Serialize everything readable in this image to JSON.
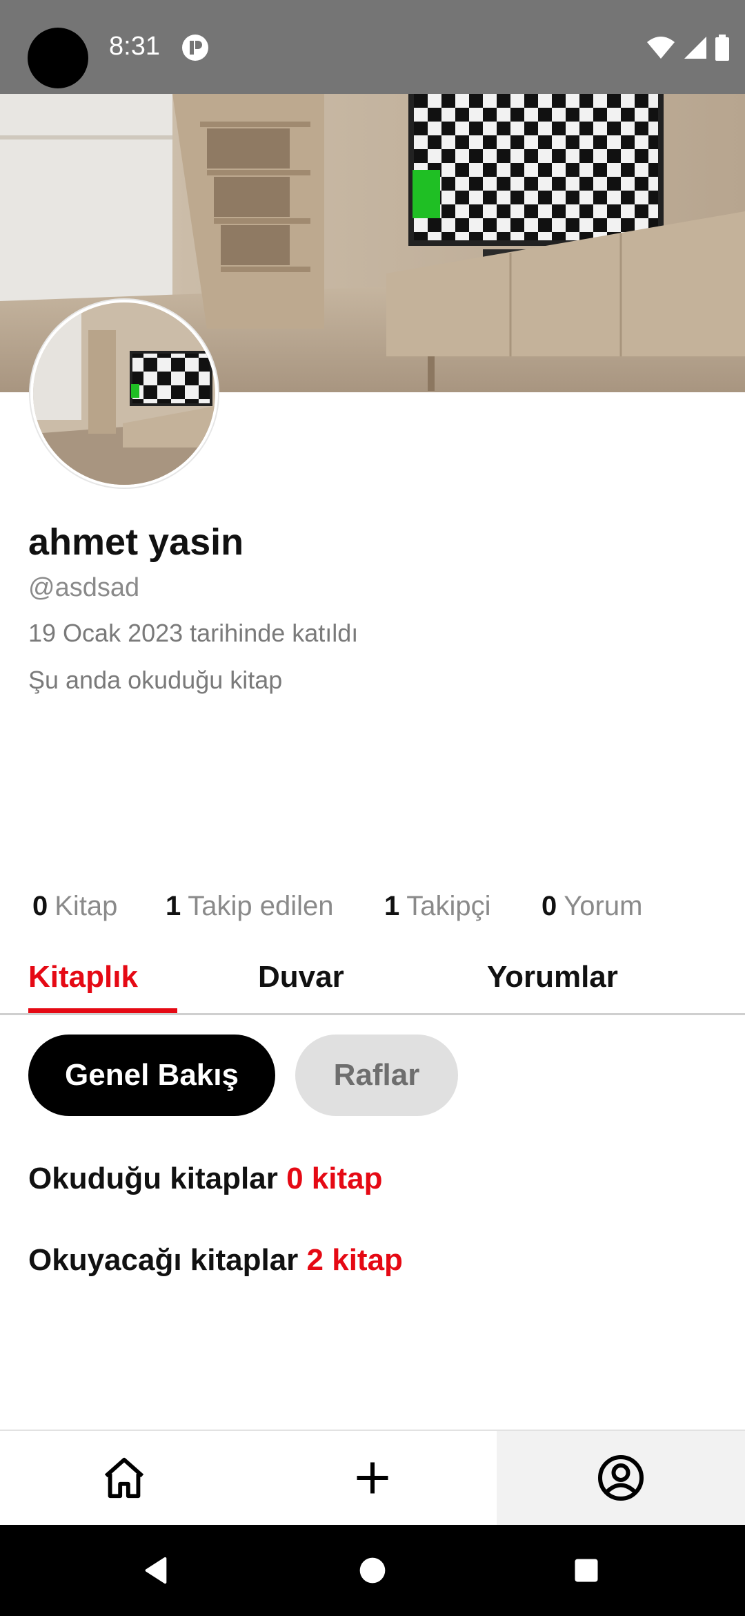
{
  "status_bar": {
    "time": "8:31"
  },
  "profile": {
    "name": "ahmet yasin",
    "handle": "@asdsad",
    "joined": "19 Ocak 2023 tarihinde katıldı",
    "currently_reading": "Şu anda okuduğu kitap"
  },
  "stats": {
    "books": {
      "count": "0",
      "label": "Kitap"
    },
    "following": {
      "count": "1",
      "label": "Takip edilen"
    },
    "followers": {
      "count": "1",
      "label": "Takipçi"
    },
    "reviews": {
      "count": "0",
      "label": "Yorum"
    }
  },
  "tabs": [
    {
      "label": "Kitaplık",
      "active": true
    },
    {
      "label": "Duvar",
      "active": false
    },
    {
      "label": "Yorumlar",
      "active": false
    }
  ],
  "chips": {
    "overview": "Genel Bakış",
    "shelves": "Raflar"
  },
  "books": {
    "read_label": "Okuduğu kitaplar",
    "read_count": "0 kitap",
    "to_read_label": "Okuyacağı kitaplar",
    "to_read_count": "2 kitap"
  },
  "bottom_nav": {
    "items": [
      "home-icon",
      "add-icon",
      "profile-icon"
    ],
    "active": "profile-icon"
  },
  "colors": {
    "accent": "#e50914",
    "status_bar": "#757575",
    "chip_active": "#000000",
    "chip_inactive": "#e0e0e0"
  }
}
